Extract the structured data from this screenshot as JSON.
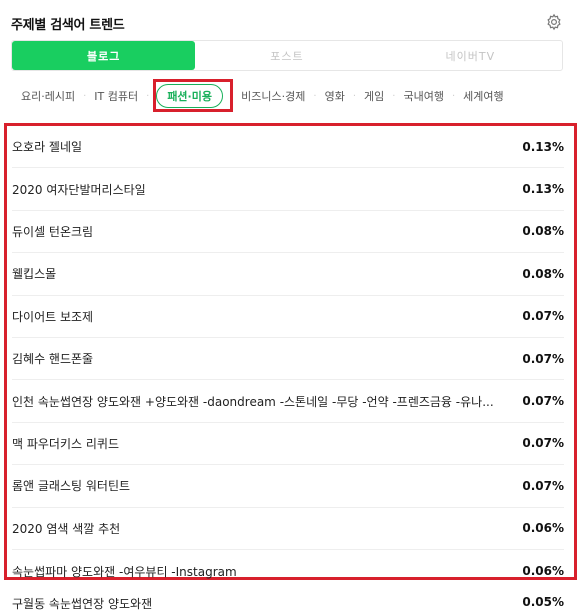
{
  "header": {
    "title": "주제별 검색어 트렌드",
    "settings_icon": "gear-icon"
  },
  "tabs": [
    {
      "label": "블로그",
      "active": true
    },
    {
      "label": "포스트",
      "active": false
    },
    {
      "label": "네이버TV",
      "active": false
    }
  ],
  "categories": [
    {
      "label": "요리·레시피",
      "active": false
    },
    {
      "label": "IT 컴퓨터",
      "active": false
    },
    {
      "label": "패션·미용",
      "active": true
    },
    {
      "label": "비즈니스·경제",
      "active": false
    },
    {
      "label": "영화",
      "active": false
    },
    {
      "label": "게임",
      "active": false
    },
    {
      "label": "국내여행",
      "active": false
    },
    {
      "label": "세계여행",
      "active": false
    }
  ],
  "rows": [
    {
      "keyword": "오호라 젤네일",
      "percent": "0.13%"
    },
    {
      "keyword": "2020 여자단발머리스타일",
      "percent": "0.13%"
    },
    {
      "keyword": "듀이셀 턴온크림",
      "percent": "0.08%"
    },
    {
      "keyword": "웰킵스몰",
      "percent": "0.08%"
    },
    {
      "keyword": "다이어트 보조제",
      "percent": "0.07%"
    },
    {
      "keyword": "김혜수 핸드폰줄",
      "percent": "0.07%"
    },
    {
      "keyword": "인천 속눈썹연장 양도와잰 +양도와잰 -daondream -스톤네일 -무당 -언약 -프렌즈금융 -유나...",
      "percent": "0.07%"
    },
    {
      "keyword": "맥 파우더키스 리퀴드",
      "percent": "0.07%"
    },
    {
      "keyword": "롬앤 글래스팅 워터틴트",
      "percent": "0.07%"
    },
    {
      "keyword": "2020 염색 색깔 추천",
      "percent": "0.06%"
    },
    {
      "keyword": "속눈썹파마 양도와잰 -여우뷰티 -Instagram",
      "percent": "0.06%"
    }
  ],
  "extra_row": {
    "keyword": "구월동 속눈썹연장 양도와잰",
    "percent": "0.05%"
  },
  "colors": {
    "accent_green": "#19ce60",
    "highlight_red": "#d8202c"
  }
}
